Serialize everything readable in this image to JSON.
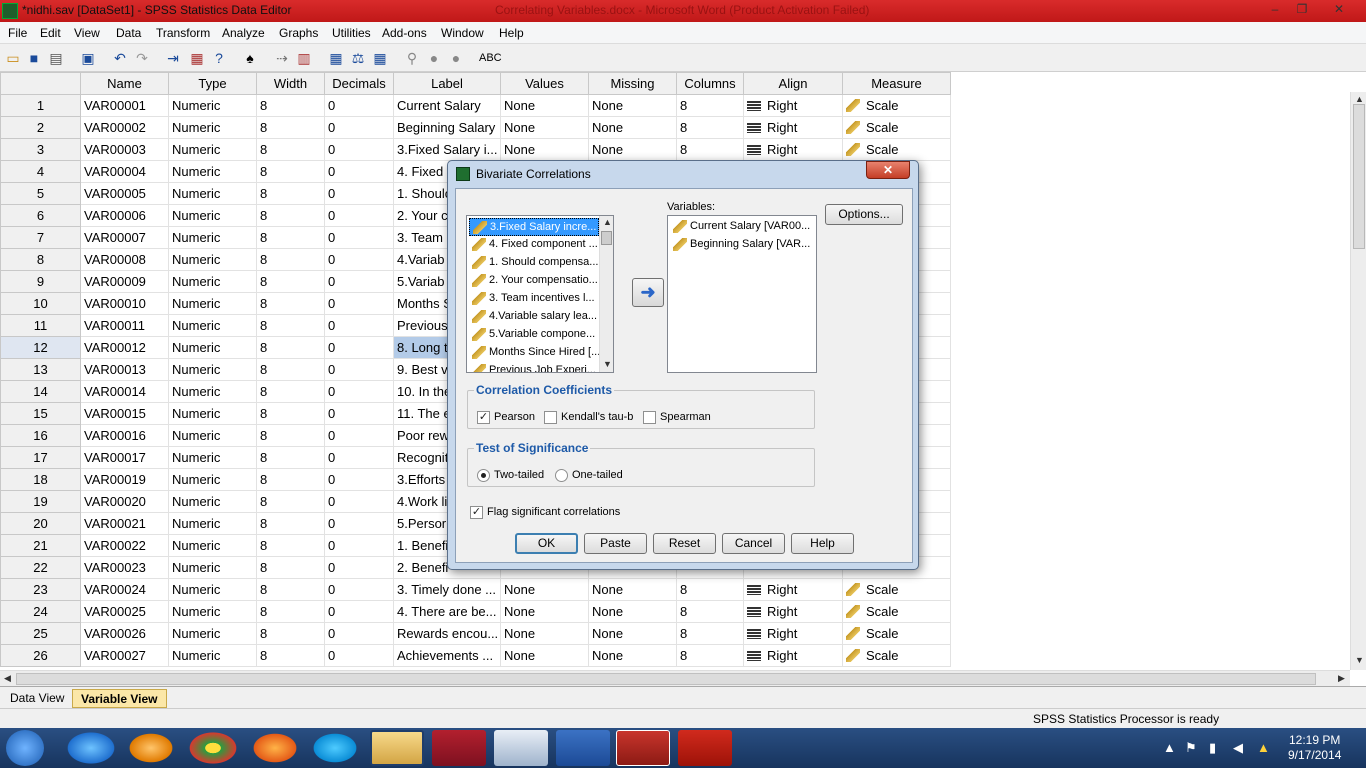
{
  "window": {
    "title": "*nidhi.sav [DataSet1] - SPSS Statistics Data Editor",
    "ghost_title": "Correlating Variables.docx - Microsoft Word (Product Activation Failed)",
    "minimize": "–",
    "maximize": "❐",
    "close": "✕"
  },
  "menu": [
    "File",
    "Edit",
    "View",
    "Data",
    "Transform",
    "Analyze",
    "Graphs",
    "Utilities",
    "Add-ons",
    "Window",
    "Help"
  ],
  "grid": {
    "columns": [
      "Name",
      "Type",
      "Width",
      "Decimals",
      "Label",
      "Values",
      "Missing",
      "Columns",
      "Align",
      "Measure"
    ],
    "rows": [
      {
        "num": "1",
        "name": "VAR00001",
        "type": "Numeric",
        "width": "8",
        "decimals": "0",
        "label": "Current Salary",
        "values": "None",
        "missing": "None",
        "columns": "8",
        "align": "Right",
        "measure": "Scale"
      },
      {
        "num": "2",
        "name": "VAR00002",
        "type": "Numeric",
        "width": "8",
        "decimals": "0",
        "label": "Beginning Salary",
        "values": "None",
        "missing": "None",
        "columns": "8",
        "align": "Right",
        "measure": "Scale"
      },
      {
        "num": "3",
        "name": "VAR00003",
        "type": "Numeric",
        "width": "8",
        "decimals": "0",
        "label": "3.Fixed Salary i...",
        "values": "None",
        "missing": "None",
        "columns": "8",
        "align": "Right",
        "measure": "Scale"
      },
      {
        "num": "4",
        "name": "VAR00004",
        "type": "Numeric",
        "width": "8",
        "decimals": "0",
        "label": "4. Fixed",
        "values": "",
        "missing": "",
        "columns": "",
        "align": "",
        "measure": ""
      },
      {
        "num": "5",
        "name": "VAR00005",
        "type": "Numeric",
        "width": "8",
        "decimals": "0",
        "label": "1. Shoulc",
        "values": "",
        "missing": "",
        "columns": "",
        "align": "",
        "measure": ""
      },
      {
        "num": "6",
        "name": "VAR00006",
        "type": "Numeric",
        "width": "8",
        "decimals": "0",
        "label": "2. Your c",
        "values": "",
        "missing": "",
        "columns": "",
        "align": "",
        "measure": ""
      },
      {
        "num": "7",
        "name": "VAR00007",
        "type": "Numeric",
        "width": "8",
        "decimals": "0",
        "label": "3. Team",
        "values": "",
        "missing": "",
        "columns": "",
        "align": "",
        "measure": ""
      },
      {
        "num": "8",
        "name": "VAR00008",
        "type": "Numeric",
        "width": "8",
        "decimals": "0",
        "label": "4.Variab",
        "values": "",
        "missing": "",
        "columns": "",
        "align": "",
        "measure": ""
      },
      {
        "num": "9",
        "name": "VAR00009",
        "type": "Numeric",
        "width": "8",
        "decimals": "0",
        "label": "5.Variab",
        "values": "",
        "missing": "",
        "columns": "",
        "align": "",
        "measure": ""
      },
      {
        "num": "10",
        "name": "VAR00010",
        "type": "Numeric",
        "width": "8",
        "decimals": "0",
        "label": "Months S",
        "values": "",
        "missing": "",
        "columns": "",
        "align": "",
        "measure": ""
      },
      {
        "num": "11",
        "name": "VAR00011",
        "type": "Numeric",
        "width": "8",
        "decimals": "0",
        "label": "Previous",
        "values": "",
        "missing": "",
        "columns": "",
        "align": "",
        "measure": ""
      },
      {
        "num": "12",
        "name": "VAR00012",
        "type": "Numeric",
        "width": "8",
        "decimals": "0",
        "label": "8. Long t",
        "values": "",
        "missing": "",
        "columns": "",
        "align": "",
        "measure": ""
      },
      {
        "num": "13",
        "name": "VAR00013",
        "type": "Numeric",
        "width": "8",
        "decimals": "0",
        "label": "9. Best v",
        "values": "",
        "missing": "",
        "columns": "",
        "align": "",
        "measure": ""
      },
      {
        "num": "14",
        "name": "VAR00014",
        "type": "Numeric",
        "width": "8",
        "decimals": "0",
        "label": "10. In the",
        "values": "",
        "missing": "",
        "columns": "",
        "align": "",
        "measure": ""
      },
      {
        "num": "15",
        "name": "VAR00015",
        "type": "Numeric",
        "width": "8",
        "decimals": "0",
        "label": "11. The e",
        "values": "",
        "missing": "",
        "columns": "",
        "align": "",
        "measure": ""
      },
      {
        "num": "16",
        "name": "VAR00016",
        "type": "Numeric",
        "width": "8",
        "decimals": "0",
        "label": "Poor rew",
        "values": "",
        "missing": "",
        "columns": "",
        "align": "",
        "measure": ""
      },
      {
        "num": "17",
        "name": "VAR00017",
        "type": "Numeric",
        "width": "8",
        "decimals": "0",
        "label": "Recognit",
        "values": "",
        "missing": "",
        "columns": "",
        "align": "",
        "measure": ""
      },
      {
        "num": "18",
        "name": "VAR00019",
        "type": "Numeric",
        "width": "8",
        "decimals": "0",
        "label": "3.Efforts",
        "values": "",
        "missing": "",
        "columns": "",
        "align": "",
        "measure": ""
      },
      {
        "num": "19",
        "name": "VAR00020",
        "type": "Numeric",
        "width": "8",
        "decimals": "0",
        "label": "4.Work li",
        "values": "",
        "missing": "",
        "columns": "",
        "align": "",
        "measure": ""
      },
      {
        "num": "20",
        "name": "VAR00021",
        "type": "Numeric",
        "width": "8",
        "decimals": "0",
        "label": "5.Persor",
        "values": "",
        "missing": "",
        "columns": "",
        "align": "",
        "measure": ""
      },
      {
        "num": "21",
        "name": "VAR00022",
        "type": "Numeric",
        "width": "8",
        "decimals": "0",
        "label": "1. Benefi",
        "values": "",
        "missing": "",
        "columns": "",
        "align": "",
        "measure": ""
      },
      {
        "num": "22",
        "name": "VAR00023",
        "type": "Numeric",
        "width": "8",
        "decimals": "0",
        "label": "2. Benefi",
        "values": "",
        "missing": "",
        "columns": "",
        "align": "",
        "measure": ""
      },
      {
        "num": "23",
        "name": "VAR00024",
        "type": "Numeric",
        "width": "8",
        "decimals": "0",
        "label": "3. Timely done ...",
        "values": "None",
        "missing": "None",
        "columns": "8",
        "align": "Right",
        "measure": "Scale"
      },
      {
        "num": "24",
        "name": "VAR00025",
        "type": "Numeric",
        "width": "8",
        "decimals": "0",
        "label": "4. There are be...",
        "values": "None",
        "missing": "None",
        "columns": "8",
        "align": "Right",
        "measure": "Scale"
      },
      {
        "num": "25",
        "name": "VAR00026",
        "type": "Numeric",
        "width": "8",
        "decimals": "0",
        "label": "Rewards encou...",
        "values": "None",
        "missing": "None",
        "columns": "8",
        "align": "Right",
        "measure": "Scale"
      },
      {
        "num": "26",
        "name": "VAR00027",
        "type": "Numeric",
        "width": "8",
        "decimals": "0",
        "label": "Achievements ...",
        "values": "None",
        "missing": "None",
        "columns": "8",
        "align": "Right",
        "measure": "Scale"
      }
    ],
    "selected_row": "12"
  },
  "tabs": {
    "data_view": "Data View",
    "variable_view": "Variable View"
  },
  "status": "SPSS Statistics  Processor is ready",
  "taskbar": {
    "time": "12:19 PM",
    "date": "9/17/2014"
  },
  "dialog": {
    "title": "Bivariate Correlations",
    "close": "✕",
    "source_items": [
      "3.Fixed Salary incre...",
      "4. Fixed component ...",
      "1. Should compensa...",
      "2. Your compensatio...",
      "3. Team incentives l...",
      "4.Variable salary lea...",
      "5.Variable compone...",
      "Months Since Hired [...",
      "Previous Job Experi..."
    ],
    "variables_label": "Variables:",
    "variables_items": [
      "Current Salary [VAR00...",
      "Beginning Salary [VAR..."
    ],
    "options_label": "Options...",
    "move_arrow": "➜",
    "correlation_group": "Correlation Coefficients",
    "pearson": "Pearson",
    "pearson_checked": true,
    "kendall": "Kendall's tau-b",
    "kendall_checked": false,
    "spearman": "Spearman",
    "spearman_checked": false,
    "significance_group": "Test of Significance",
    "two_tailed": "Two-tailed",
    "one_tailed": "One-tailed",
    "selected_test": "two_tailed",
    "flag": "Flag significant correlations",
    "flag_checked": true,
    "buttons": {
      "ok": "OK",
      "paste": "Paste",
      "reset": "Reset",
      "cancel": "Cancel",
      "help": "Help"
    }
  }
}
